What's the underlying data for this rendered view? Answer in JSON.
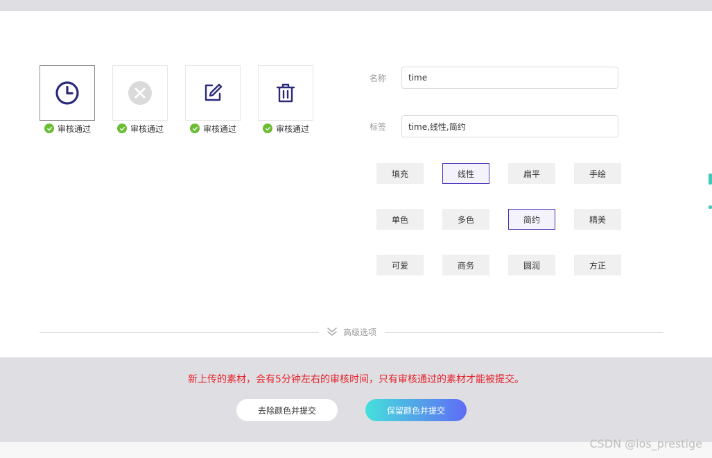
{
  "icons": [
    {
      "name": "clock",
      "status": "审核通过",
      "selected": true
    },
    {
      "name": "close-circle",
      "status": "审核通过",
      "selected": false
    },
    {
      "name": "edit",
      "status": "审核通过",
      "selected": false
    },
    {
      "name": "trash",
      "status": "审核通过",
      "selected": false
    }
  ],
  "form": {
    "name_label": "名称",
    "name_value": "time",
    "tags_label": "标签",
    "tags_value": "time,线性,简约"
  },
  "tags": [
    {
      "label": "填充",
      "active": false
    },
    {
      "label": "线性",
      "active": true
    },
    {
      "label": "扁平",
      "active": false
    },
    {
      "label": "手绘",
      "active": false
    },
    {
      "label": "单色",
      "active": false
    },
    {
      "label": "多色",
      "active": false
    },
    {
      "label": "简约",
      "active": true
    },
    {
      "label": "精美",
      "active": false
    },
    {
      "label": "可爱",
      "active": false
    },
    {
      "label": "商务",
      "active": false
    },
    {
      "label": "圆润",
      "active": false
    },
    {
      "label": "方正",
      "active": false
    }
  ],
  "advanced": {
    "label": "高级选项"
  },
  "footer": {
    "warning": "新上传的素材，会有5分钟左右的审核时间，只有审核通过的素材才能被提交。",
    "remove_color_button": "去除颜色并提交",
    "keep_color_button": "保留颜色并提交"
  },
  "watermark": "CSDN @ios_prestige",
  "colors": {
    "icon_stroke": "#2b2a7a",
    "approved_green": "#6bbd33",
    "active_tag_border": "#4433b8",
    "warning_red": "#e6212a",
    "gradient_start": "#45e0db",
    "gradient_end": "#5f6cf5",
    "footer_bg": "#dfdfe3"
  }
}
